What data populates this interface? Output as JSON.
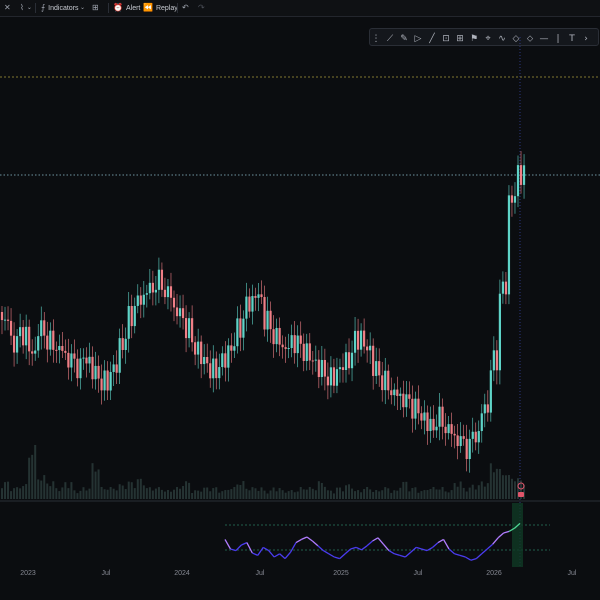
{
  "toolbar": {
    "indicators_label": "Indicators",
    "alert_label": "Alert",
    "replay_label": "Replay",
    "icons": [
      "close-icon",
      "chart-type-icon",
      "chevron-down-icon",
      "indicators-icon",
      "templates-icon",
      "alert-icon",
      "replay-icon",
      "undo-icon",
      "redo-icon"
    ]
  },
  "drawing_tools": {
    "icons": [
      "grip-icon",
      "trend-line-icon",
      "brush-icon",
      "play-icon",
      "ray-icon",
      "rectangle-icon",
      "grid-icon",
      "flag-icon",
      "pin-icon",
      "path-icon",
      "arrow-up-icon",
      "arrow-down-icon",
      "horizontal-line-icon",
      "vertical-line-icon",
      "text-icon",
      "more-icon"
    ]
  },
  "x_axis": {
    "labels": [
      "2023",
      "Jul",
      "2024",
      "Jul",
      "2025",
      "Jul",
      "2026",
      "Jul"
    ]
  },
  "colors": {
    "up": "#5fd4c8",
    "down": "#f07f86",
    "background": "#0b0d10",
    "grid_dash": "#a89a3b",
    "price_line": "#8fc1d0",
    "rsi_line_low": "#4b3cf0",
    "rsi_line_high": "#b07cff",
    "rsi_line_end": "#4ed493",
    "rsi_band": "#2a7a60"
  },
  "chart_data": {
    "type": "candlestick",
    "x_range": [
      "2022-12",
      "2026-08"
    ],
    "price_levels_dashed": [
      "resistance-high",
      "current-price"
    ],
    "close_approx": [
      62,
      56,
      58,
      54,
      60,
      57,
      55,
      52,
      50,
      52,
      49,
      47,
      50,
      56,
      63,
      67,
      70,
      72,
      69,
      64,
      60,
      55,
      52,
      50,
      52,
      55,
      60,
      66,
      68,
      62,
      58,
      55,
      56,
      54,
      52,
      50,
      48,
      50,
      52,
      57,
      55,
      50,
      47,
      44,
      42,
      40,
      38,
      36,
      38,
      35,
      32,
      30,
      33,
      40,
      52,
      70,
      92,
      98
    ],
    "volume_relative": [
      0.3,
      0.2,
      0.25,
      0.9,
      0.4,
      0.3,
      0.2,
      0.3,
      0.15,
      0.2,
      0.6,
      0.2,
      0.2,
      0.25,
      0.3,
      0.35,
      0.2,
      0.2,
      0.15,
      0.2,
      0.3,
      0.15,
      0.2,
      0.2,
      0.15,
      0.2,
      0.3,
      0.2,
      0.2,
      0.15,
      0.2,
      0.15,
      0.15,
      0.2,
      0.2,
      0.3,
      0.15,
      0.2,
      0.25,
      0.15,
      0.2,
      0.15,
      0.2,
      0.15,
      0.3,
      0.2,
      0.15,
      0.2,
      0.2,
      0.15,
      0.3,
      0.2,
      0.25,
      0.3,
      0.6,
      0.5,
      0.4,
      0.35
    ],
    "rsi_values": [
      62,
      50,
      48,
      55,
      58,
      45,
      42,
      52,
      48,
      40,
      44,
      38,
      46,
      58,
      62,
      65,
      60,
      54,
      48,
      44,
      40,
      38,
      44,
      50,
      52,
      49,
      54,
      60,
      64,
      56,
      48,
      44,
      42,
      40,
      46,
      52,
      50,
      48,
      52,
      58,
      62,
      50,
      44,
      42,
      40,
      36,
      38,
      44,
      50,
      56,
      64,
      70,
      72,
      76,
      82
    ]
  }
}
